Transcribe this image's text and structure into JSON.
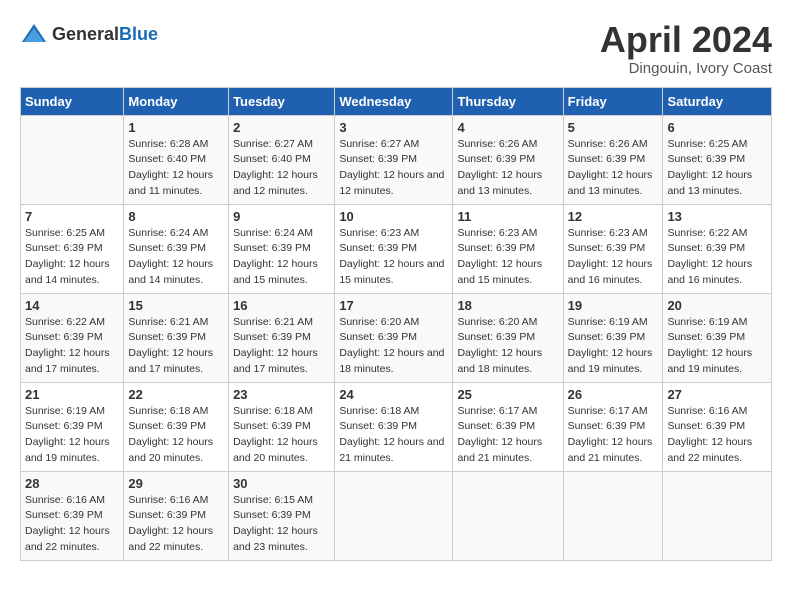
{
  "header": {
    "logo_general": "General",
    "logo_blue": "Blue",
    "main_title": "April 2024",
    "subtitle": "Dingouin, Ivory Coast"
  },
  "days_of_week": [
    "Sunday",
    "Monday",
    "Tuesday",
    "Wednesday",
    "Thursday",
    "Friday",
    "Saturday"
  ],
  "weeks": [
    [
      {
        "day": "",
        "sunrise": "",
        "sunset": "",
        "daylight": ""
      },
      {
        "day": "1",
        "sunrise": "Sunrise: 6:28 AM",
        "sunset": "Sunset: 6:40 PM",
        "daylight": "Daylight: 12 hours and 11 minutes."
      },
      {
        "day": "2",
        "sunrise": "Sunrise: 6:27 AM",
        "sunset": "Sunset: 6:40 PM",
        "daylight": "Daylight: 12 hours and 12 minutes."
      },
      {
        "day": "3",
        "sunrise": "Sunrise: 6:27 AM",
        "sunset": "Sunset: 6:39 PM",
        "daylight": "Daylight: 12 hours and 12 minutes."
      },
      {
        "day": "4",
        "sunrise": "Sunrise: 6:26 AM",
        "sunset": "Sunset: 6:39 PM",
        "daylight": "Daylight: 12 hours and 13 minutes."
      },
      {
        "day": "5",
        "sunrise": "Sunrise: 6:26 AM",
        "sunset": "Sunset: 6:39 PM",
        "daylight": "Daylight: 12 hours and 13 minutes."
      },
      {
        "day": "6",
        "sunrise": "Sunrise: 6:25 AM",
        "sunset": "Sunset: 6:39 PM",
        "daylight": "Daylight: 12 hours and 13 minutes."
      }
    ],
    [
      {
        "day": "7",
        "sunrise": "Sunrise: 6:25 AM",
        "sunset": "Sunset: 6:39 PM",
        "daylight": "Daylight: 12 hours and 14 minutes."
      },
      {
        "day": "8",
        "sunrise": "Sunrise: 6:24 AM",
        "sunset": "Sunset: 6:39 PM",
        "daylight": "Daylight: 12 hours and 14 minutes."
      },
      {
        "day": "9",
        "sunrise": "Sunrise: 6:24 AM",
        "sunset": "Sunset: 6:39 PM",
        "daylight": "Daylight: 12 hours and 15 minutes."
      },
      {
        "day": "10",
        "sunrise": "Sunrise: 6:23 AM",
        "sunset": "Sunset: 6:39 PM",
        "daylight": "Daylight: 12 hours and 15 minutes."
      },
      {
        "day": "11",
        "sunrise": "Sunrise: 6:23 AM",
        "sunset": "Sunset: 6:39 PM",
        "daylight": "Daylight: 12 hours and 15 minutes."
      },
      {
        "day": "12",
        "sunrise": "Sunrise: 6:23 AM",
        "sunset": "Sunset: 6:39 PM",
        "daylight": "Daylight: 12 hours and 16 minutes."
      },
      {
        "day": "13",
        "sunrise": "Sunrise: 6:22 AM",
        "sunset": "Sunset: 6:39 PM",
        "daylight": "Daylight: 12 hours and 16 minutes."
      }
    ],
    [
      {
        "day": "14",
        "sunrise": "Sunrise: 6:22 AM",
        "sunset": "Sunset: 6:39 PM",
        "daylight": "Daylight: 12 hours and 17 minutes."
      },
      {
        "day": "15",
        "sunrise": "Sunrise: 6:21 AM",
        "sunset": "Sunset: 6:39 PM",
        "daylight": "Daylight: 12 hours and 17 minutes."
      },
      {
        "day": "16",
        "sunrise": "Sunrise: 6:21 AM",
        "sunset": "Sunset: 6:39 PM",
        "daylight": "Daylight: 12 hours and 17 minutes."
      },
      {
        "day": "17",
        "sunrise": "Sunrise: 6:20 AM",
        "sunset": "Sunset: 6:39 PM",
        "daylight": "Daylight: 12 hours and 18 minutes."
      },
      {
        "day": "18",
        "sunrise": "Sunrise: 6:20 AM",
        "sunset": "Sunset: 6:39 PM",
        "daylight": "Daylight: 12 hours and 18 minutes."
      },
      {
        "day": "19",
        "sunrise": "Sunrise: 6:19 AM",
        "sunset": "Sunset: 6:39 PM",
        "daylight": "Daylight: 12 hours and 19 minutes."
      },
      {
        "day": "20",
        "sunrise": "Sunrise: 6:19 AM",
        "sunset": "Sunset: 6:39 PM",
        "daylight": "Daylight: 12 hours and 19 minutes."
      }
    ],
    [
      {
        "day": "21",
        "sunrise": "Sunrise: 6:19 AM",
        "sunset": "Sunset: 6:39 PM",
        "daylight": "Daylight: 12 hours and 19 minutes."
      },
      {
        "day": "22",
        "sunrise": "Sunrise: 6:18 AM",
        "sunset": "Sunset: 6:39 PM",
        "daylight": "Daylight: 12 hours and 20 minutes."
      },
      {
        "day": "23",
        "sunrise": "Sunrise: 6:18 AM",
        "sunset": "Sunset: 6:39 PM",
        "daylight": "Daylight: 12 hours and 20 minutes."
      },
      {
        "day": "24",
        "sunrise": "Sunrise: 6:18 AM",
        "sunset": "Sunset: 6:39 PM",
        "daylight": "Daylight: 12 hours and 21 minutes."
      },
      {
        "day": "25",
        "sunrise": "Sunrise: 6:17 AM",
        "sunset": "Sunset: 6:39 PM",
        "daylight": "Daylight: 12 hours and 21 minutes."
      },
      {
        "day": "26",
        "sunrise": "Sunrise: 6:17 AM",
        "sunset": "Sunset: 6:39 PM",
        "daylight": "Daylight: 12 hours and 21 minutes."
      },
      {
        "day": "27",
        "sunrise": "Sunrise: 6:16 AM",
        "sunset": "Sunset: 6:39 PM",
        "daylight": "Daylight: 12 hours and 22 minutes."
      }
    ],
    [
      {
        "day": "28",
        "sunrise": "Sunrise: 6:16 AM",
        "sunset": "Sunset: 6:39 PM",
        "daylight": "Daylight: 12 hours and 22 minutes."
      },
      {
        "day": "29",
        "sunrise": "Sunrise: 6:16 AM",
        "sunset": "Sunset: 6:39 PM",
        "daylight": "Daylight: 12 hours and 22 minutes."
      },
      {
        "day": "30",
        "sunrise": "Sunrise: 6:15 AM",
        "sunset": "Sunset: 6:39 PM",
        "daylight": "Daylight: 12 hours and 23 minutes."
      },
      {
        "day": "",
        "sunrise": "",
        "sunset": "",
        "daylight": ""
      },
      {
        "day": "",
        "sunrise": "",
        "sunset": "",
        "daylight": ""
      },
      {
        "day": "",
        "sunrise": "",
        "sunset": "",
        "daylight": ""
      },
      {
        "day": "",
        "sunrise": "",
        "sunset": "",
        "daylight": ""
      }
    ]
  ]
}
